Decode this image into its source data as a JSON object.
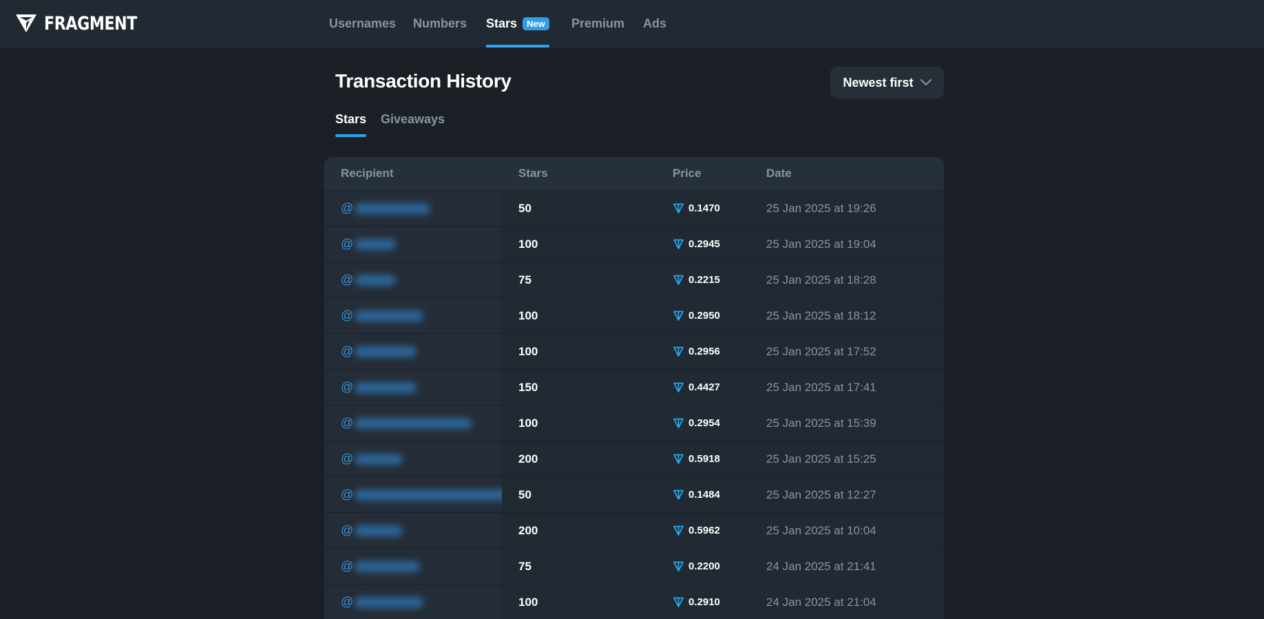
{
  "brand": {
    "name": "FRAGMENT"
  },
  "nav": {
    "items": [
      {
        "label": "Usernames",
        "active": false
      },
      {
        "label": "Numbers",
        "active": false
      },
      {
        "label": "Stars",
        "active": true,
        "badge": "New"
      },
      {
        "label": "Premium",
        "active": false
      },
      {
        "label": "Ads",
        "active": false
      }
    ]
  },
  "page": {
    "title": "Transaction History",
    "sort_label": "Newest first"
  },
  "subtabs": [
    {
      "label": "Stars",
      "active": true
    },
    {
      "label": "Giveaways",
      "active": false
    }
  ],
  "table": {
    "headers": {
      "recipient": "Recipient",
      "stars": "Stars",
      "price": "Price",
      "date": "Date"
    },
    "rows": [
      {
        "recipient_prefix": "@",
        "stars": "50",
        "price": "0.1470",
        "date": "25 Jan 2025 at 19:26"
      },
      {
        "recipient_prefix": "@",
        "stars": "100",
        "price": "0.2945",
        "date": "25 Jan 2025 at 19:04"
      },
      {
        "recipient_prefix": "@",
        "stars": "75",
        "price": "0.2215",
        "date": "25 Jan 2025 at 18:28"
      },
      {
        "recipient_prefix": "@",
        "stars": "100",
        "price": "0.2950",
        "date": "25 Jan 2025 at 18:12"
      },
      {
        "recipient_prefix": "@",
        "stars": "100",
        "price": "0.2956",
        "date": "25 Jan 2025 at 17:52"
      },
      {
        "recipient_prefix": "@",
        "stars": "150",
        "price": "0.4427",
        "date": "25 Jan 2025 at 17:41"
      },
      {
        "recipient_prefix": "@",
        "stars": "100",
        "price": "0.2954",
        "date": "25 Jan 2025 at 15:39"
      },
      {
        "recipient_prefix": "@",
        "stars": "200",
        "price": "0.5918",
        "date": "25 Jan 2025 at 15:25"
      },
      {
        "recipient_prefix": "@",
        "stars": "50",
        "price": "0.1484",
        "date": "25 Jan 2025 at 12:27"
      },
      {
        "recipient_prefix": "@",
        "stars": "200",
        "price": "0.5962",
        "date": "25 Jan 2025 at 10:04"
      },
      {
        "recipient_prefix": "@",
        "stars": "75",
        "price": "0.2200",
        "date": "24 Jan 2025 at 21:41"
      },
      {
        "recipient_prefix": "@",
        "stars": "100",
        "price": "0.2910",
        "date": "24 Jan 2025 at 21:04"
      }
    ]
  },
  "icons": {
    "logo": "fragment-logo-icon",
    "sort": "chevron-down-icon",
    "currency": "ton-icon"
  },
  "colors": {
    "accent": "#2aa6f0",
    "badge": "#2f9de7",
    "ton": "#2aa6f0"
  }
}
